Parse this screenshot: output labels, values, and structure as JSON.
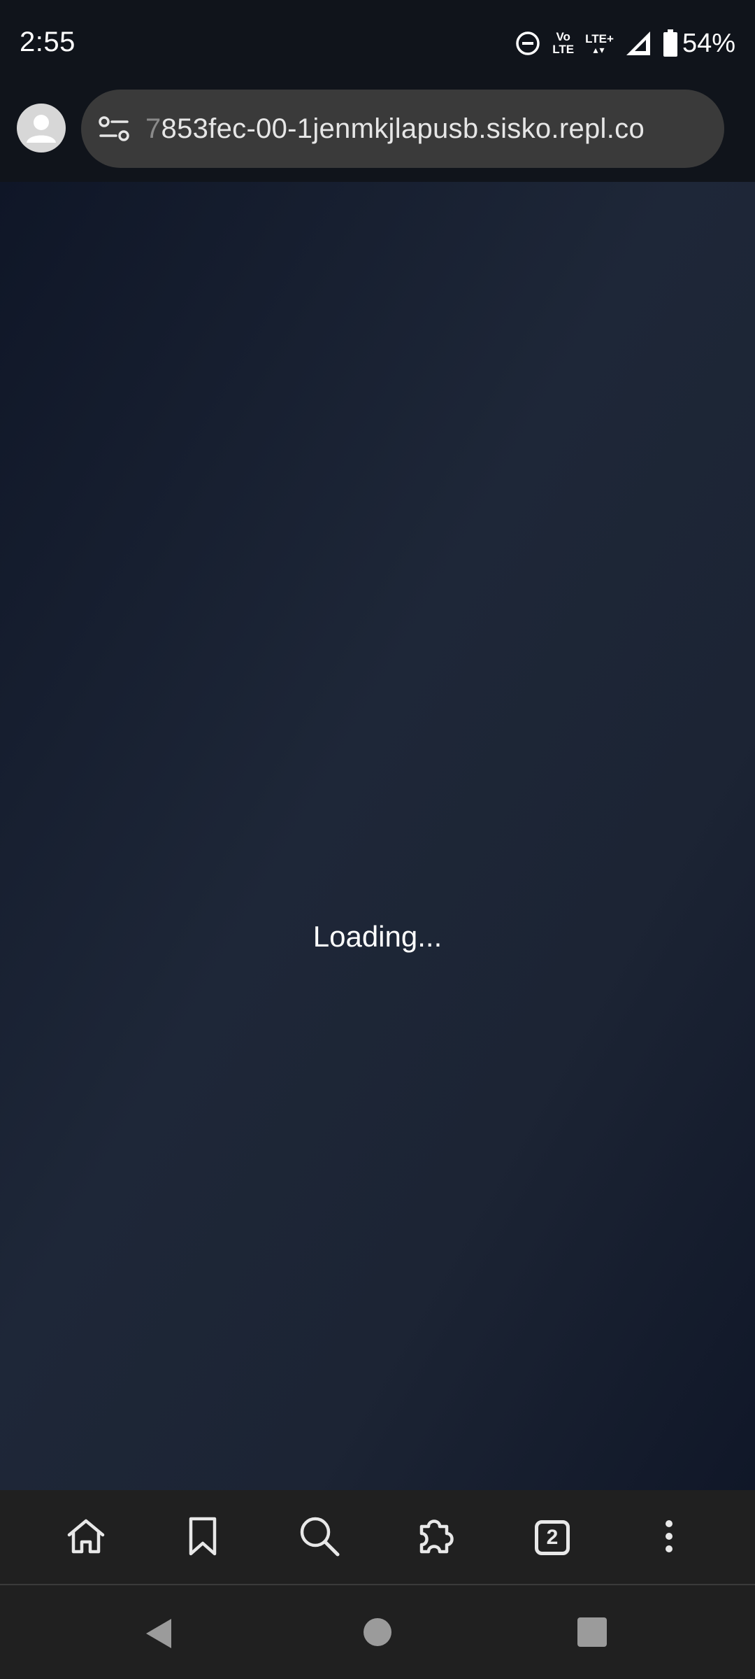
{
  "status_bar": {
    "time": "2:55",
    "volte_top": "Vo",
    "volte_bottom": "LTE",
    "lte_label": "LTE+",
    "battery_percent": "54%",
    "icons": [
      "do-not-disturb-icon",
      "volte-icon",
      "lte-plus-icon",
      "signal-icon",
      "battery-icon"
    ]
  },
  "address_bar": {
    "url_faded_prefix": "7",
    "url": "853fec-00-1jenmkjlapusb.sisko.repl.co",
    "icons": [
      "profile-avatar-icon",
      "site-settings-icon"
    ]
  },
  "page": {
    "loading_text": "Loading..."
  },
  "bottom_toolbar": {
    "tab_count": "2",
    "icons": [
      "home-icon",
      "bookmark-icon",
      "search-icon",
      "extensions-icon",
      "tabs-icon",
      "more-menu-icon"
    ]
  },
  "system_nav": {
    "icons": [
      "back-icon",
      "home-circle-icon",
      "recents-icon"
    ]
  },
  "colors": {
    "status_bg": "#10141b",
    "url_pill": "#3a3a3a",
    "content_gradient_dark": "#0f1627",
    "content_gradient_light": "#1e2738",
    "toolbar_bg": "#202020",
    "icon_light": "#e8e8e8",
    "nav_gray": "#9b9b9b"
  }
}
